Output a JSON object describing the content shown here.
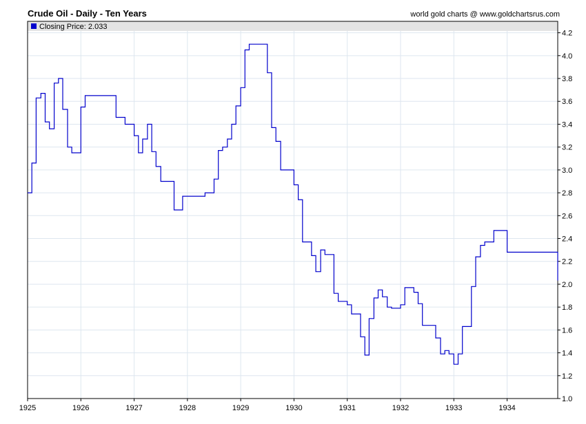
{
  "header": {
    "title": "Crude Oil - Daily - Ten Years",
    "source": "world gold charts @ www.goldchartsrus.com"
  },
  "legend": {
    "label": "Closing Price: 2.033"
  },
  "colors": {
    "series": "#0000cc",
    "legend_swatch": "#0000cc",
    "legend_band": "#e4e4e4",
    "grid": "#dde6ef"
  },
  "chart_data": {
    "type": "line",
    "title": "Crude Oil - Daily - Ten Years",
    "xlabel": "",
    "ylabel": "",
    "xlim": [
      1925,
      1934.95
    ],
    "ylim": [
      1.0,
      4.3
    ],
    "y_axis_position": "right",
    "x_ticks": [
      "1925",
      "1926",
      "1927",
      "1928",
      "1929",
      "1930",
      "1931",
      "1932",
      "1933",
      "1934"
    ],
    "y_ticks": [
      1.0,
      1.2,
      1.4,
      1.6,
      1.8,
      2.0,
      2.2,
      2.4,
      2.6,
      2.8,
      3.0,
      3.2,
      3.4,
      3.6,
      3.8,
      4.0,
      4.2
    ],
    "grid": true,
    "legend_position": "top-left",
    "series": [
      {
        "name": "Closing Price",
        "step": true,
        "x": [
          1925.0,
          1925.08,
          1925.16,
          1925.25,
          1925.33,
          1925.41,
          1925.5,
          1925.58,
          1925.66,
          1925.75,
          1925.83,
          1926.0,
          1926.08,
          1926.58,
          1926.66,
          1926.83,
          1926.91,
          1927.0,
          1927.08,
          1927.16,
          1927.25,
          1927.33,
          1927.41,
          1927.5,
          1927.66,
          1927.75,
          1927.83,
          1927.91,
          1928.33,
          1928.41,
          1928.5,
          1928.58,
          1928.66,
          1928.75,
          1928.83,
          1928.91,
          1929.0,
          1929.08,
          1929.16,
          1929.25,
          1929.33,
          1929.41,
          1929.5,
          1929.58,
          1929.66,
          1929.75,
          1929.83,
          1930.0,
          1930.08,
          1930.16,
          1930.33,
          1930.41,
          1930.5,
          1930.58,
          1930.75,
          1930.83,
          1930.91,
          1931.0,
          1931.08,
          1931.25,
          1931.33,
          1931.41,
          1931.5,
          1931.58,
          1931.66,
          1931.75,
          1931.83,
          1932.0,
          1932.08,
          1932.16,
          1932.25,
          1932.33,
          1932.41,
          1932.66,
          1932.75,
          1932.83,
          1932.91,
          1933.0,
          1933.08,
          1933.16,
          1933.33,
          1933.41,
          1933.5,
          1933.58,
          1933.66,
          1933.75,
          1933.83,
          1934.0,
          1934.41,
          1934.5,
          1934.91,
          1934.95
        ],
        "values": [
          2.8,
          3.06,
          3.63,
          3.67,
          3.42,
          3.36,
          3.76,
          3.8,
          3.53,
          3.2,
          3.15,
          3.55,
          3.65,
          3.65,
          3.46,
          3.4,
          3.4,
          3.3,
          3.15,
          3.27,
          3.4,
          3.16,
          3.03,
          2.9,
          2.9,
          2.65,
          2.65,
          2.77,
          2.8,
          2.8,
          2.92,
          3.17,
          3.2,
          3.27,
          3.4,
          3.56,
          3.72,
          4.05,
          4.1,
          4.1,
          4.1,
          4.1,
          3.85,
          3.37,
          3.25,
          3.0,
          3.0,
          2.87,
          2.74,
          2.37,
          2.25,
          2.11,
          2.3,
          2.26,
          1.92,
          1.85,
          1.85,
          1.82,
          1.74,
          1.54,
          1.38,
          1.7,
          1.88,
          1.95,
          1.89,
          1.8,
          1.79,
          1.82,
          1.97,
          1.97,
          1.93,
          1.83,
          1.64,
          1.53,
          1.39,
          1.42,
          1.39,
          1.3,
          1.39,
          1.63,
          1.98,
          2.24,
          2.34,
          2.37,
          2.37,
          2.47,
          2.47,
          2.28,
          2.28,
          2.28,
          2.28,
          2.033
        ]
      }
    ]
  }
}
